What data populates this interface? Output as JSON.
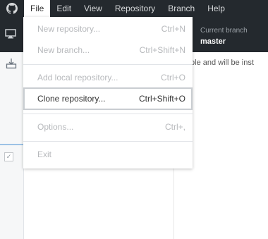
{
  "menubar": {
    "logo": "github-octocat-icon",
    "items": [
      "File",
      "Edit",
      "View",
      "Repository",
      "Branch",
      "Help"
    ],
    "active": "File"
  },
  "branch": {
    "label": "Current branch",
    "name": "master"
  },
  "main": {
    "notice": "ilable and will be inst"
  },
  "file_menu": {
    "items": [
      {
        "label": "New repository...",
        "shortcut": "Ctrl+N",
        "enabled": false
      },
      {
        "label": "New branch...",
        "shortcut": "Ctrl+Shift+N",
        "enabled": false
      },
      {
        "label": "Add local repository...",
        "shortcut": "Ctrl+O",
        "enabled": false
      },
      {
        "label": "Clone repository...",
        "shortcut": "Ctrl+Shift+O",
        "enabled": true
      },
      {
        "label": "Options...",
        "shortcut": "Ctrl+,",
        "enabled": false
      },
      {
        "label": "Exit",
        "shortcut": "",
        "enabled": false
      }
    ]
  },
  "colors": {
    "titlebar": "#24292e",
    "highlight_border": "#c9cdd1",
    "disabled_text": "#b7b9bc"
  }
}
